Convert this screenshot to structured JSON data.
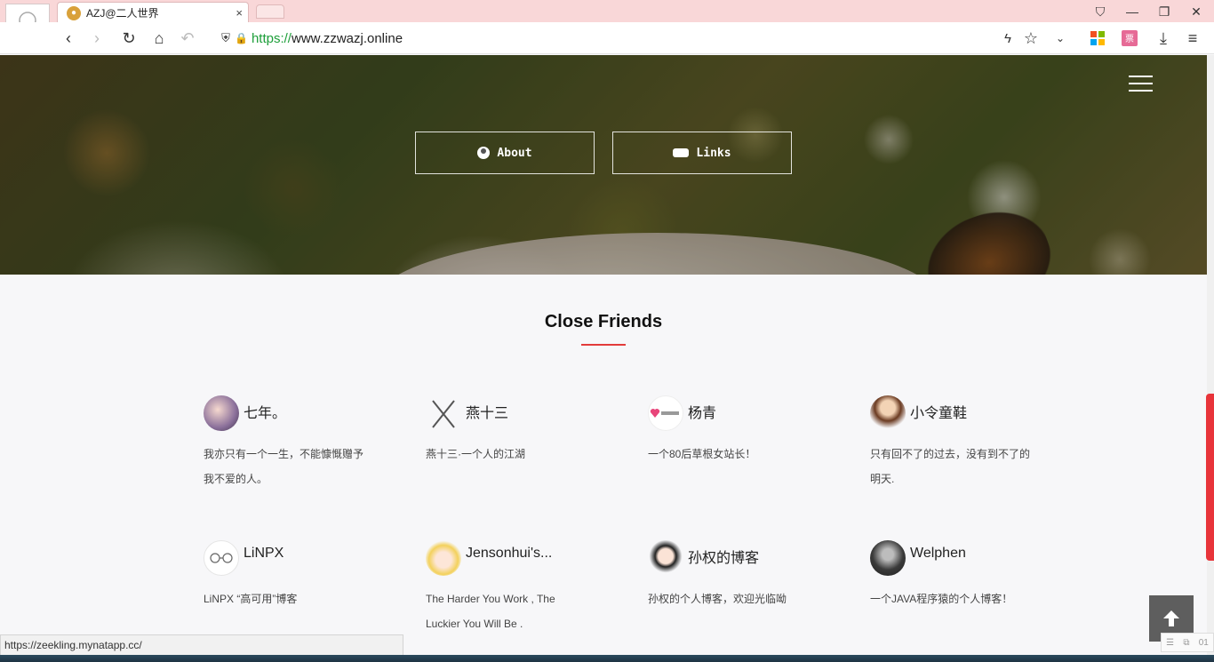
{
  "browser": {
    "tab_title": "AZJ@二人世界",
    "tab_close": "×",
    "url_scheme": "https://",
    "url_host": "www.zzwazj.online",
    "status_url": "https://zeekling.mynatapp.cc/"
  },
  "hero": {
    "buttons": [
      {
        "label": "About",
        "icon": "user-circle-icon"
      },
      {
        "label": "Links",
        "icon": "handshake-icon"
      }
    ]
  },
  "friends": {
    "title": "Close Friends",
    "accent_color": "#e23b3b",
    "items": [
      {
        "name": "七年。",
        "desc": "我亦只有一个一生，不能慷慨赠予我不爱的人。"
      },
      {
        "name": "燕十三",
        "desc": "燕十三·一个人的江湖"
      },
      {
        "name": "杨青",
        "desc": "一个80后草根女站长！"
      },
      {
        "name": "小令童鞋",
        "desc": "只有回不了的过去，没有到不了的明天."
      },
      {
        "name": "LiNPX",
        "desc": "LiNPX “高可用”博客"
      },
      {
        "name": "Jensonhui's...",
        "desc": "The Harder You Work , The Luckier You Will Be ."
      },
      {
        "name": "孙权的博客",
        "desc": "孙权的个人博客，欢迎光临呦"
      },
      {
        "name": "Welphen",
        "desc": "一个JAVA程序猿的个人博客！"
      }
    ]
  },
  "widgets": {
    "mini_text": "01"
  }
}
